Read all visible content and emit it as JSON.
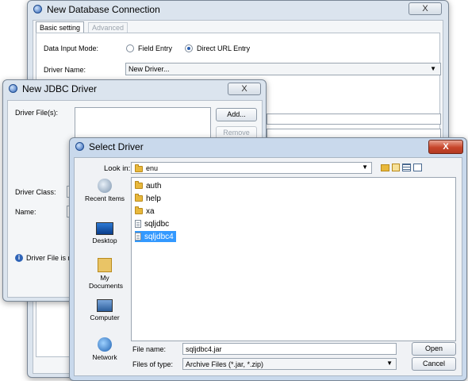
{
  "db_dialog": {
    "title": "New Database Connection",
    "close": "X",
    "tabs": [
      "Basic setting",
      "Advanced"
    ],
    "data_input_mode_label": "Data Input Mode:",
    "radio_field_entry": "Field Entry",
    "radio_direct_url": "Direct URL Entry",
    "driver_name_label": "Driver Name:",
    "driver_name_value": "New Driver..."
  },
  "jdbc_dialog": {
    "title": "New JDBC Driver",
    "close": "X",
    "driver_files_label": "Driver File(s):",
    "add_button": "Add...",
    "remove_button": "Remove",
    "driver_class_label": "Driver Class:",
    "name_label": "Name:",
    "info_text": "Driver File is m"
  },
  "select_dialog": {
    "title": "Select Driver",
    "close": "X",
    "look_in_label": "Look in:",
    "look_in_value": "enu",
    "places": [
      "Recent Items",
      "Desktop",
      "My Documents",
      "Computer",
      "Network"
    ],
    "files": [
      {
        "name": "auth",
        "type": "folder"
      },
      {
        "name": "help",
        "type": "folder"
      },
      {
        "name": "xa",
        "type": "folder"
      },
      {
        "name": "sqljdbc",
        "type": "file"
      },
      {
        "name": "sqljdbc4",
        "type": "file",
        "selected": true
      }
    ],
    "file_name_label": "File name:",
    "file_name_value": "sqljdbc4.jar",
    "files_of_type_label": "Files of type:",
    "files_of_type_value": "Archive Files (*.jar, *.zip)",
    "open_button": "Open",
    "cancel_button": "Cancel"
  }
}
